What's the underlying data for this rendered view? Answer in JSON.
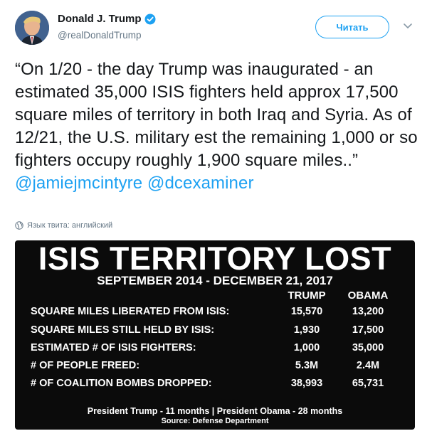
{
  "tweet": {
    "display_name": "Donald J. Trump",
    "handle": "@realDonaldTrump",
    "follow_label": "Читать",
    "text_main": "“On 1/20 - the day Trump was inaugurated - an estimated 35,000 ISIS fighters held approx 17,500 square miles of territory in both Iraq and Syria. As of 12/21, the U.S. military est the remaining 1,000 or so fighters occupy roughly 1,900 square miles..”",
    "mention_1": "@jamiejmcintyre",
    "mention_2": "@dcexaminer",
    "language_note": "Язык твита: английский"
  },
  "graphic": {
    "title": "ISIS TERRITORY LOST",
    "subtitle": "SEPTEMBER 2014 - DECEMBER 21, 2017",
    "columns": [
      "TRUMP",
      "OBAMA"
    ],
    "rows": [
      {
        "label": "SQUARE MILES LIBERATED FROM ISIS:",
        "trump": "15,570",
        "obama": "13,200"
      },
      {
        "label": "SQUARE MILES STILL HELD BY ISIS:",
        "trump": "1,930",
        "obama": "17,500"
      },
      {
        "label": "ESTIMATED # OF ISIS FIGHTERS:",
        "trump": "1,000",
        "obama": "35,000"
      },
      {
        "label": "# OF PEOPLE FREED:",
        "trump": "5.3M",
        "obama": "2.4M"
      },
      {
        "label": "# OF COALITION BOMBS DROPPED:",
        "trump": "38,993",
        "obama": "65,731"
      }
    ],
    "footer": "President Trump - 11 months | President Obama - 28 months",
    "source": "Source: Defense Department"
  },
  "colors": {
    "accent": "#1da1f2",
    "text": "#14171a",
    "muted": "#657786",
    "card_bg": "#0b0b0b"
  },
  "icons": [
    "verified-badge-icon",
    "chevron-down-icon",
    "globe-icon"
  ]
}
